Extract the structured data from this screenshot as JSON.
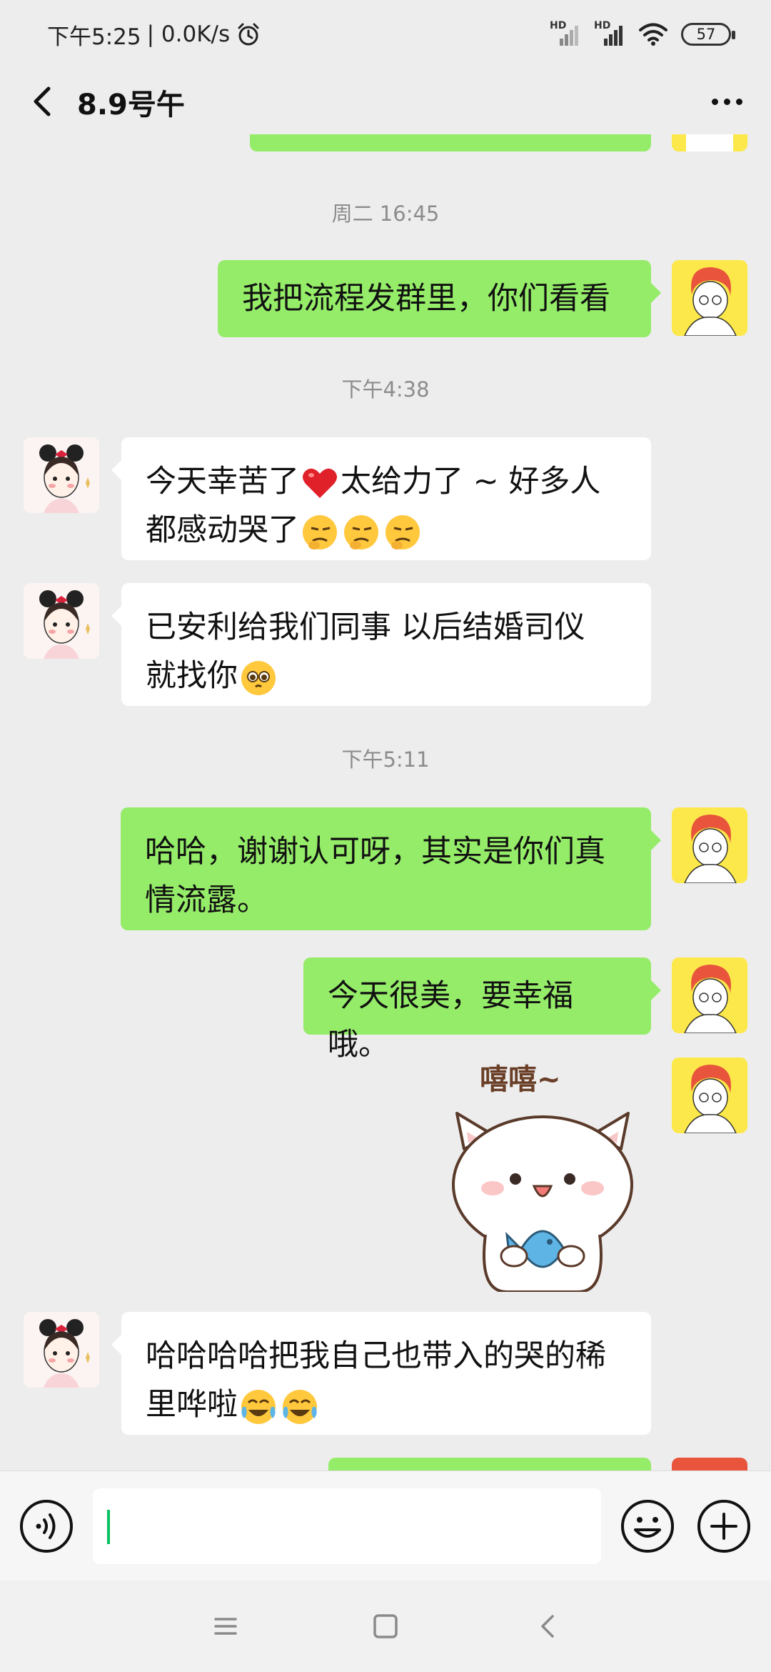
{
  "status_bar": {
    "time": "下午5:25",
    "network_speed": "| 0.0K/s",
    "signal_1_label": "HD",
    "signal_2_label": "HD",
    "battery_level": "57"
  },
  "header": {
    "title": "8.9号午"
  },
  "messages": [
    {
      "type": "timestamp",
      "text": "周二 16:45"
    },
    {
      "type": "message",
      "side": "right",
      "text": "我把流程发群里，你们看看"
    },
    {
      "type": "timestamp",
      "text": "下午4:38"
    },
    {
      "type": "message",
      "side": "left",
      "line1_a": "今天幸苦了",
      "line1_b": "太给力了 ~ 好多人",
      "line2": "都感动哭了"
    },
    {
      "type": "message",
      "side": "left",
      "line1": "已安利给我们同事 以后结婚司仪",
      "line2": "就找你"
    },
    {
      "type": "timestamp",
      "text": "下午5:11"
    },
    {
      "type": "message",
      "side": "right",
      "line1": "哈哈，谢谢认可呀，其实是你们真",
      "line2": "情流露。"
    },
    {
      "type": "message",
      "side": "right",
      "text": "今天很美，要幸福哦。"
    },
    {
      "type": "sticker",
      "side": "right",
      "caption": "嘻嘻~"
    },
    {
      "type": "message",
      "side": "left",
      "line1": "哈哈哈哈把我自己也带入的哭的稀",
      "line2": "里哗啦"
    }
  ],
  "input_bar": {
    "value": "",
    "placeholder": ""
  },
  "colors": {
    "background": "#ededed",
    "sent_bubble": "#95ec69",
    "received_bubble": "#ffffff",
    "caret": "#07c160"
  },
  "icons": {
    "back": "chevron-left-icon",
    "more": "more-dots-icon",
    "voice": "voice-icon",
    "emoji": "emoji-icon",
    "plus": "plus-icon",
    "nav_menu": "menu-icon",
    "nav_home": "home-square-icon",
    "nav_back": "back-triangle-icon"
  }
}
